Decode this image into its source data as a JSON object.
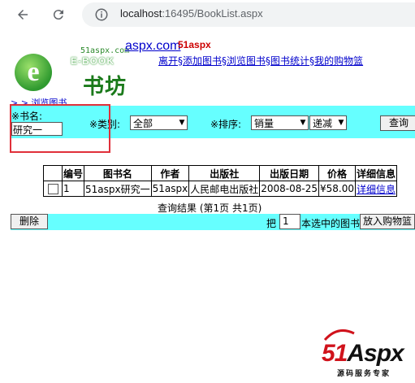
{
  "browser": {
    "url_host": "localhost",
    "url_path": ":16495/BookList.aspx"
  },
  "header": {
    "logo_site": "51aspx.com",
    "logo_ebook": "E-BOOK",
    "logo_letter": "e",
    "logo_cn": "书坊",
    "site_link": "aspx.com",
    "brand_small": "51aspx",
    "nav": [
      {
        "label": "离开"
      },
      {
        "label": "添加图书"
      },
      {
        "label": "浏览图书"
      },
      {
        "label": "图书统计"
      },
      {
        "label": "我的购物篮"
      }
    ],
    "nav_sep": "§"
  },
  "breadcrumb": "> > 浏览图书",
  "search": {
    "name_label": "※书名:",
    "name_value": "研究一",
    "category_label": "※类别:",
    "category_value": "全部",
    "sort_label": "※排序:",
    "sort_field_value": "销量",
    "sort_order_value": "递减",
    "query_button": "查询"
  },
  "table": {
    "headers": [
      "",
      "编号",
      "图书名",
      "作者",
      "出版社",
      "出版日期",
      "价格",
      "详细信息"
    ],
    "rows": [
      {
        "id": "1",
        "title": "51aspx研究一",
        "author": "51aspx",
        "publisher": "人民邮电出版社",
        "date": "2008-08-25",
        "price": "¥58.00",
        "detail": "详细信息"
      }
    ]
  },
  "result_text": "查询结果 (第1页 共1页)",
  "bottom": {
    "delete_button": "删除",
    "move_prefix": "把",
    "page_value": "1",
    "move_suffix": "本选中的图书",
    "add_basket_button": "放入购物篮"
  },
  "watermark": {
    "brand_a": "51",
    "brand_b": "Aspx",
    "tagline": "源码服务专家"
  },
  "colors": {
    "panel_bg": "#66ffff",
    "link": "#0000cc",
    "highlight": "#e0303a"
  }
}
